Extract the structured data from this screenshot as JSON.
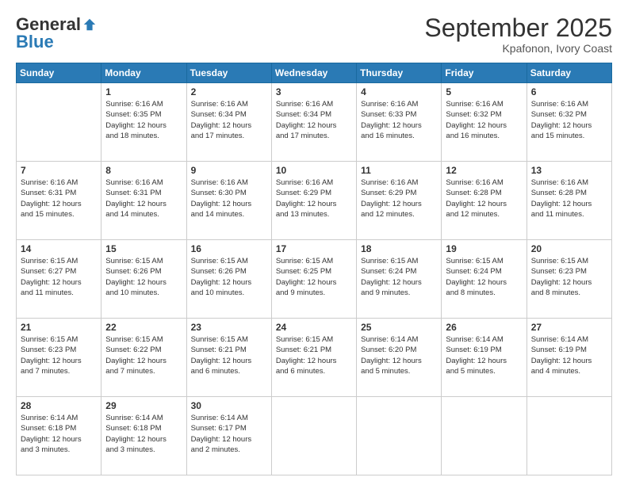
{
  "header": {
    "logo_general": "General",
    "logo_blue": "Blue",
    "month_title": "September 2025",
    "location": "Kpafonon, Ivory Coast"
  },
  "days_of_week": [
    "Sunday",
    "Monday",
    "Tuesday",
    "Wednesday",
    "Thursday",
    "Friday",
    "Saturday"
  ],
  "weeks": [
    [
      {
        "day": "",
        "info": ""
      },
      {
        "day": "1",
        "info": "Sunrise: 6:16 AM\nSunset: 6:35 PM\nDaylight: 12 hours\nand 18 minutes."
      },
      {
        "day": "2",
        "info": "Sunrise: 6:16 AM\nSunset: 6:34 PM\nDaylight: 12 hours\nand 17 minutes."
      },
      {
        "day": "3",
        "info": "Sunrise: 6:16 AM\nSunset: 6:34 PM\nDaylight: 12 hours\nand 17 minutes."
      },
      {
        "day": "4",
        "info": "Sunrise: 6:16 AM\nSunset: 6:33 PM\nDaylight: 12 hours\nand 16 minutes."
      },
      {
        "day": "5",
        "info": "Sunrise: 6:16 AM\nSunset: 6:32 PM\nDaylight: 12 hours\nand 16 minutes."
      },
      {
        "day": "6",
        "info": "Sunrise: 6:16 AM\nSunset: 6:32 PM\nDaylight: 12 hours\nand 15 minutes."
      }
    ],
    [
      {
        "day": "7",
        "info": "Sunrise: 6:16 AM\nSunset: 6:31 PM\nDaylight: 12 hours\nand 15 minutes."
      },
      {
        "day": "8",
        "info": "Sunrise: 6:16 AM\nSunset: 6:31 PM\nDaylight: 12 hours\nand 14 minutes."
      },
      {
        "day": "9",
        "info": "Sunrise: 6:16 AM\nSunset: 6:30 PM\nDaylight: 12 hours\nand 14 minutes."
      },
      {
        "day": "10",
        "info": "Sunrise: 6:16 AM\nSunset: 6:29 PM\nDaylight: 12 hours\nand 13 minutes."
      },
      {
        "day": "11",
        "info": "Sunrise: 6:16 AM\nSunset: 6:29 PM\nDaylight: 12 hours\nand 12 minutes."
      },
      {
        "day": "12",
        "info": "Sunrise: 6:16 AM\nSunset: 6:28 PM\nDaylight: 12 hours\nand 12 minutes."
      },
      {
        "day": "13",
        "info": "Sunrise: 6:16 AM\nSunset: 6:28 PM\nDaylight: 12 hours\nand 11 minutes."
      }
    ],
    [
      {
        "day": "14",
        "info": "Sunrise: 6:15 AM\nSunset: 6:27 PM\nDaylight: 12 hours\nand 11 minutes."
      },
      {
        "day": "15",
        "info": "Sunrise: 6:15 AM\nSunset: 6:26 PM\nDaylight: 12 hours\nand 10 minutes."
      },
      {
        "day": "16",
        "info": "Sunrise: 6:15 AM\nSunset: 6:26 PM\nDaylight: 12 hours\nand 10 minutes."
      },
      {
        "day": "17",
        "info": "Sunrise: 6:15 AM\nSunset: 6:25 PM\nDaylight: 12 hours\nand 9 minutes."
      },
      {
        "day": "18",
        "info": "Sunrise: 6:15 AM\nSunset: 6:24 PM\nDaylight: 12 hours\nand 9 minutes."
      },
      {
        "day": "19",
        "info": "Sunrise: 6:15 AM\nSunset: 6:24 PM\nDaylight: 12 hours\nand 8 minutes."
      },
      {
        "day": "20",
        "info": "Sunrise: 6:15 AM\nSunset: 6:23 PM\nDaylight: 12 hours\nand 8 minutes."
      }
    ],
    [
      {
        "day": "21",
        "info": "Sunrise: 6:15 AM\nSunset: 6:23 PM\nDaylight: 12 hours\nand 7 minutes."
      },
      {
        "day": "22",
        "info": "Sunrise: 6:15 AM\nSunset: 6:22 PM\nDaylight: 12 hours\nand 7 minutes."
      },
      {
        "day": "23",
        "info": "Sunrise: 6:15 AM\nSunset: 6:21 PM\nDaylight: 12 hours\nand 6 minutes."
      },
      {
        "day": "24",
        "info": "Sunrise: 6:15 AM\nSunset: 6:21 PM\nDaylight: 12 hours\nand 6 minutes."
      },
      {
        "day": "25",
        "info": "Sunrise: 6:14 AM\nSunset: 6:20 PM\nDaylight: 12 hours\nand 5 minutes."
      },
      {
        "day": "26",
        "info": "Sunrise: 6:14 AM\nSunset: 6:19 PM\nDaylight: 12 hours\nand 5 minutes."
      },
      {
        "day": "27",
        "info": "Sunrise: 6:14 AM\nSunset: 6:19 PM\nDaylight: 12 hours\nand 4 minutes."
      }
    ],
    [
      {
        "day": "28",
        "info": "Sunrise: 6:14 AM\nSunset: 6:18 PM\nDaylight: 12 hours\nand 3 minutes."
      },
      {
        "day": "29",
        "info": "Sunrise: 6:14 AM\nSunset: 6:18 PM\nDaylight: 12 hours\nand 3 minutes."
      },
      {
        "day": "30",
        "info": "Sunrise: 6:14 AM\nSunset: 6:17 PM\nDaylight: 12 hours\nand 2 minutes."
      },
      {
        "day": "",
        "info": ""
      },
      {
        "day": "",
        "info": ""
      },
      {
        "day": "",
        "info": ""
      },
      {
        "day": "",
        "info": ""
      }
    ]
  ]
}
